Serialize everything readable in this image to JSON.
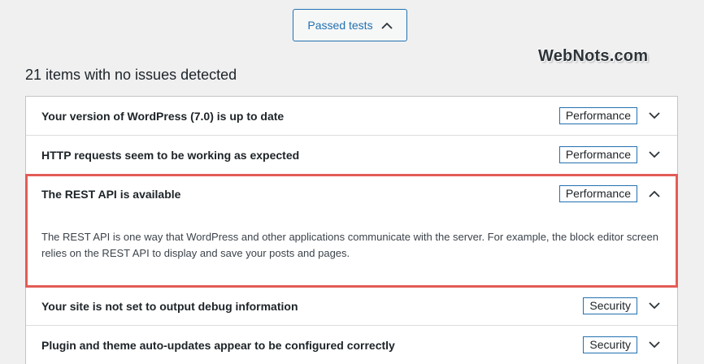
{
  "toggle": {
    "label": "Passed tests",
    "icon": "chevron-up-icon"
  },
  "watermark": "WebNots.com",
  "heading": "21 items with no issues detected",
  "colors": {
    "accent": "#2271b1",
    "highlight": "#e35d56"
  },
  "items": [
    {
      "title": "Your version of WordPress (7.0) is up to date",
      "badge": "Performance",
      "expanded": false
    },
    {
      "title": "HTTP requests seem to be working as expected",
      "badge": "Performance",
      "expanded": false
    },
    {
      "title": "The REST API is available",
      "badge": "Performance",
      "expanded": true,
      "description": "The REST API is one way that WordPress and other applications communicate with the server. For example, the block editor screen relies on the REST API to display and save your posts and pages."
    },
    {
      "title": "Your site is not set to output debug information",
      "badge": "Security",
      "expanded": false
    },
    {
      "title": "Plugin and theme auto-updates appear to be configured correctly",
      "badge": "Security",
      "expanded": false
    }
  ]
}
